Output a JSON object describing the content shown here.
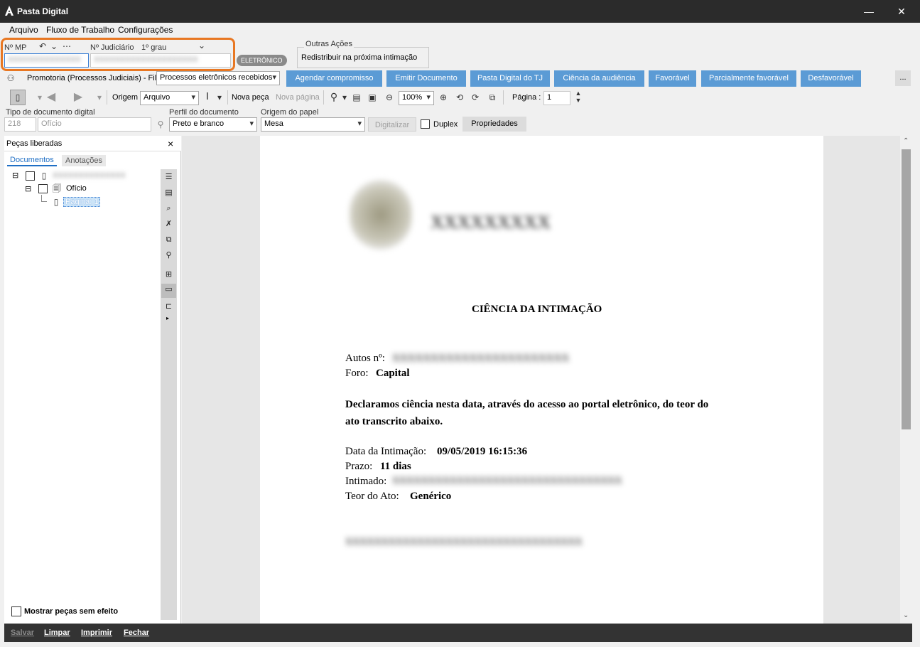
{
  "window": {
    "title": "Pasta Digital",
    "minimize": "—",
    "close": "✕"
  },
  "menu": [
    {
      "label": "Arquivo"
    },
    {
      "label": "Fluxo de Trabalho"
    },
    {
      "label": "Configurações"
    }
  ],
  "ids": {
    "mp_label": "Nº MP",
    "judicial_label": "Nº Judiciário",
    "degree": "1º grau",
    "mp_value": "XXXXXXXXXXXXXX",
    "judicial_value": "XXXXXXXXXXXXXXXXXXXX",
    "badge": "ELETRÔNICO"
  },
  "other_actions": {
    "title": "Outras Ações",
    "item": "Redistribuir na próxima intimação"
  },
  "queue": {
    "label": "Promotoria (Processos Judiciais) - Fila",
    "selected": "Processos eletrônicos recebidos"
  },
  "action_buttons": [
    {
      "label": "Agendar compromisso"
    },
    {
      "label": "Emitir Documento"
    },
    {
      "label": "Pasta Digital do TJ"
    },
    {
      "label": "Ciência da audiência"
    },
    {
      "label": "Favorável"
    },
    {
      "label": "Parcialmente favorável"
    },
    {
      "label": "Desfavorável"
    }
  ],
  "more_button": "...",
  "toolbar": {
    "origin_label": "Origem",
    "origin_value": "Arquivo",
    "new_piece": "Nova peça",
    "new_page": "Nova página",
    "zoom": "100%",
    "page_label": "Página :",
    "page_value": "1"
  },
  "docbar": {
    "type_label": "Tipo de documento digital",
    "type_code": "218",
    "type_name": "Ofício",
    "profile_label": "Perfil do documento",
    "profile_value": "Preto e branco",
    "origin_label": "Origem do papel",
    "origin_value": "Mesa",
    "scan": "Digitalizar",
    "duplex": "Duplex",
    "properties": "Propriedades"
  },
  "left_panel": {
    "title": "Peças liberadas",
    "close": "×",
    "tabs": [
      {
        "label": "Documentos"
      },
      {
        "label": "Anotações"
      }
    ],
    "tree": {
      "root": "XXXXXXXXXXXXXX",
      "doc": "Ofício",
      "page": "Página: 1"
    },
    "show_no_effect": "Mostrar peças sem efeito"
  },
  "document": {
    "org_name": "XXXXXXXXX",
    "heading": "CIÊNCIA DA INTIMAÇÃO",
    "autos_label": "Autos nº:",
    "autos_value": "XXXXXXXXXXXXXXXXXXXXXXX",
    "foro_label": "Foro:",
    "foro_value": "Capital",
    "declaration": "Declaramos ciência nesta data, através do acesso ao portal eletrônico, do teor do",
    "declaration2": "ato transcrito abaixo.",
    "date_label": "Data da Intimação:",
    "date_value": "09/05/2019 16:15:36",
    "prazo_label": "Prazo:",
    "prazo_value": "11 dias",
    "intimado_label": "Intimado:",
    "intimado_value": "XXXXXXXXXXXXXXXXXXXXXXXXXXXXXXXX",
    "teor_label": "Teor do Ato:",
    "teor_value": "Genérico",
    "footer_blur": "XXXXXXXXXXXXXXXXXXXXXXXXXXXXXXXXX"
  },
  "bottom_buttons": [
    {
      "label": "Salvar"
    },
    {
      "label": "Limpar"
    },
    {
      "label": "Imprimir"
    },
    {
      "label": "Fechar"
    }
  ]
}
